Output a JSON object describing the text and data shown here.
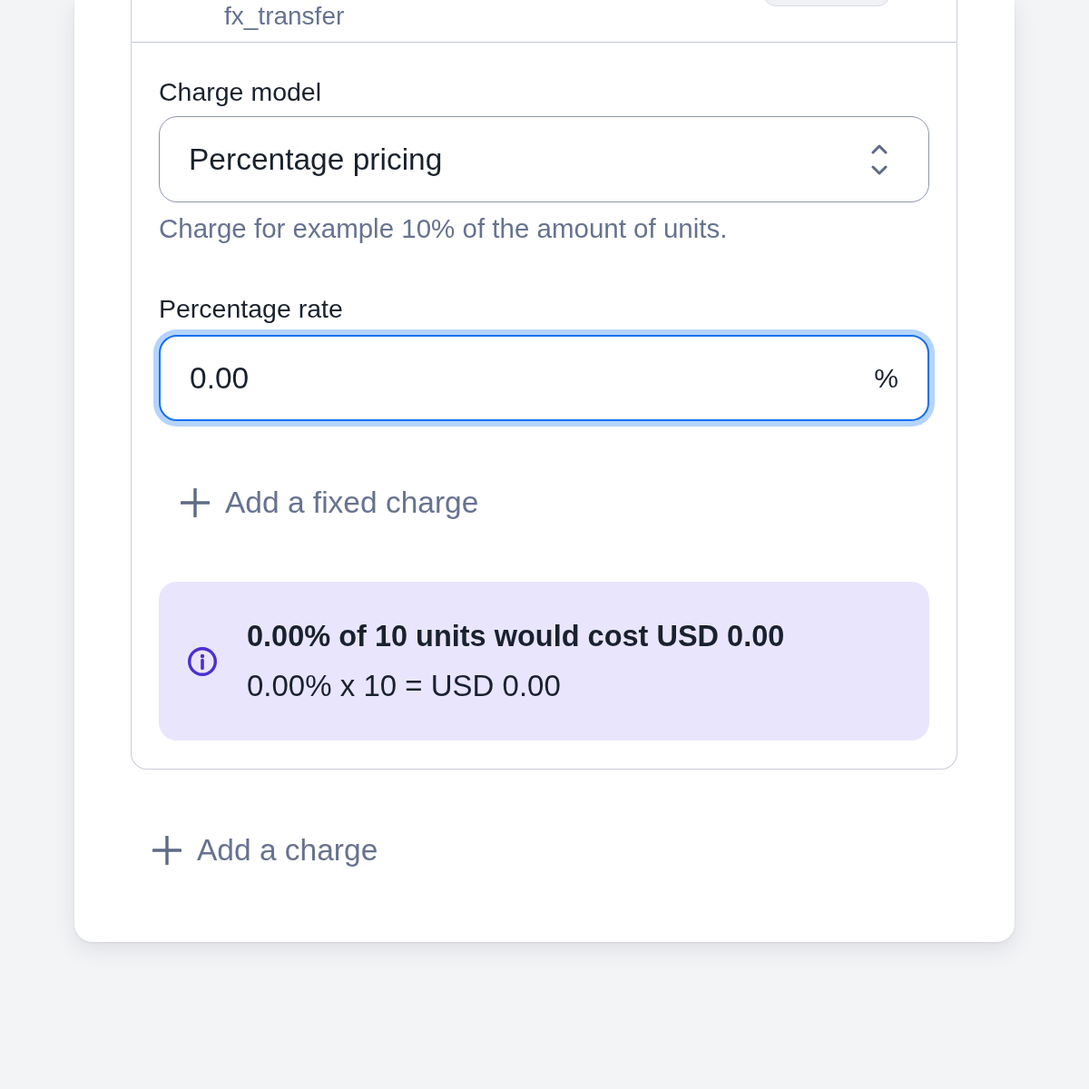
{
  "previous_row": {
    "name": "fx_transfer"
  },
  "charge_model": {
    "label": "Charge model",
    "value": "Percentage pricing",
    "help": "Charge for example 10% of the amount of units."
  },
  "percentage_rate": {
    "label": "Percentage rate",
    "value": "0.00",
    "suffix": "%",
    "focused": true
  },
  "add_fixed_charge": {
    "label": "Add a fixed charge"
  },
  "info": {
    "title": "0.00% of 10 units would cost USD 0.00",
    "formula": "0.00% x 10 = USD 0.00"
  },
  "add_charge": {
    "label": "Add a charge"
  }
}
